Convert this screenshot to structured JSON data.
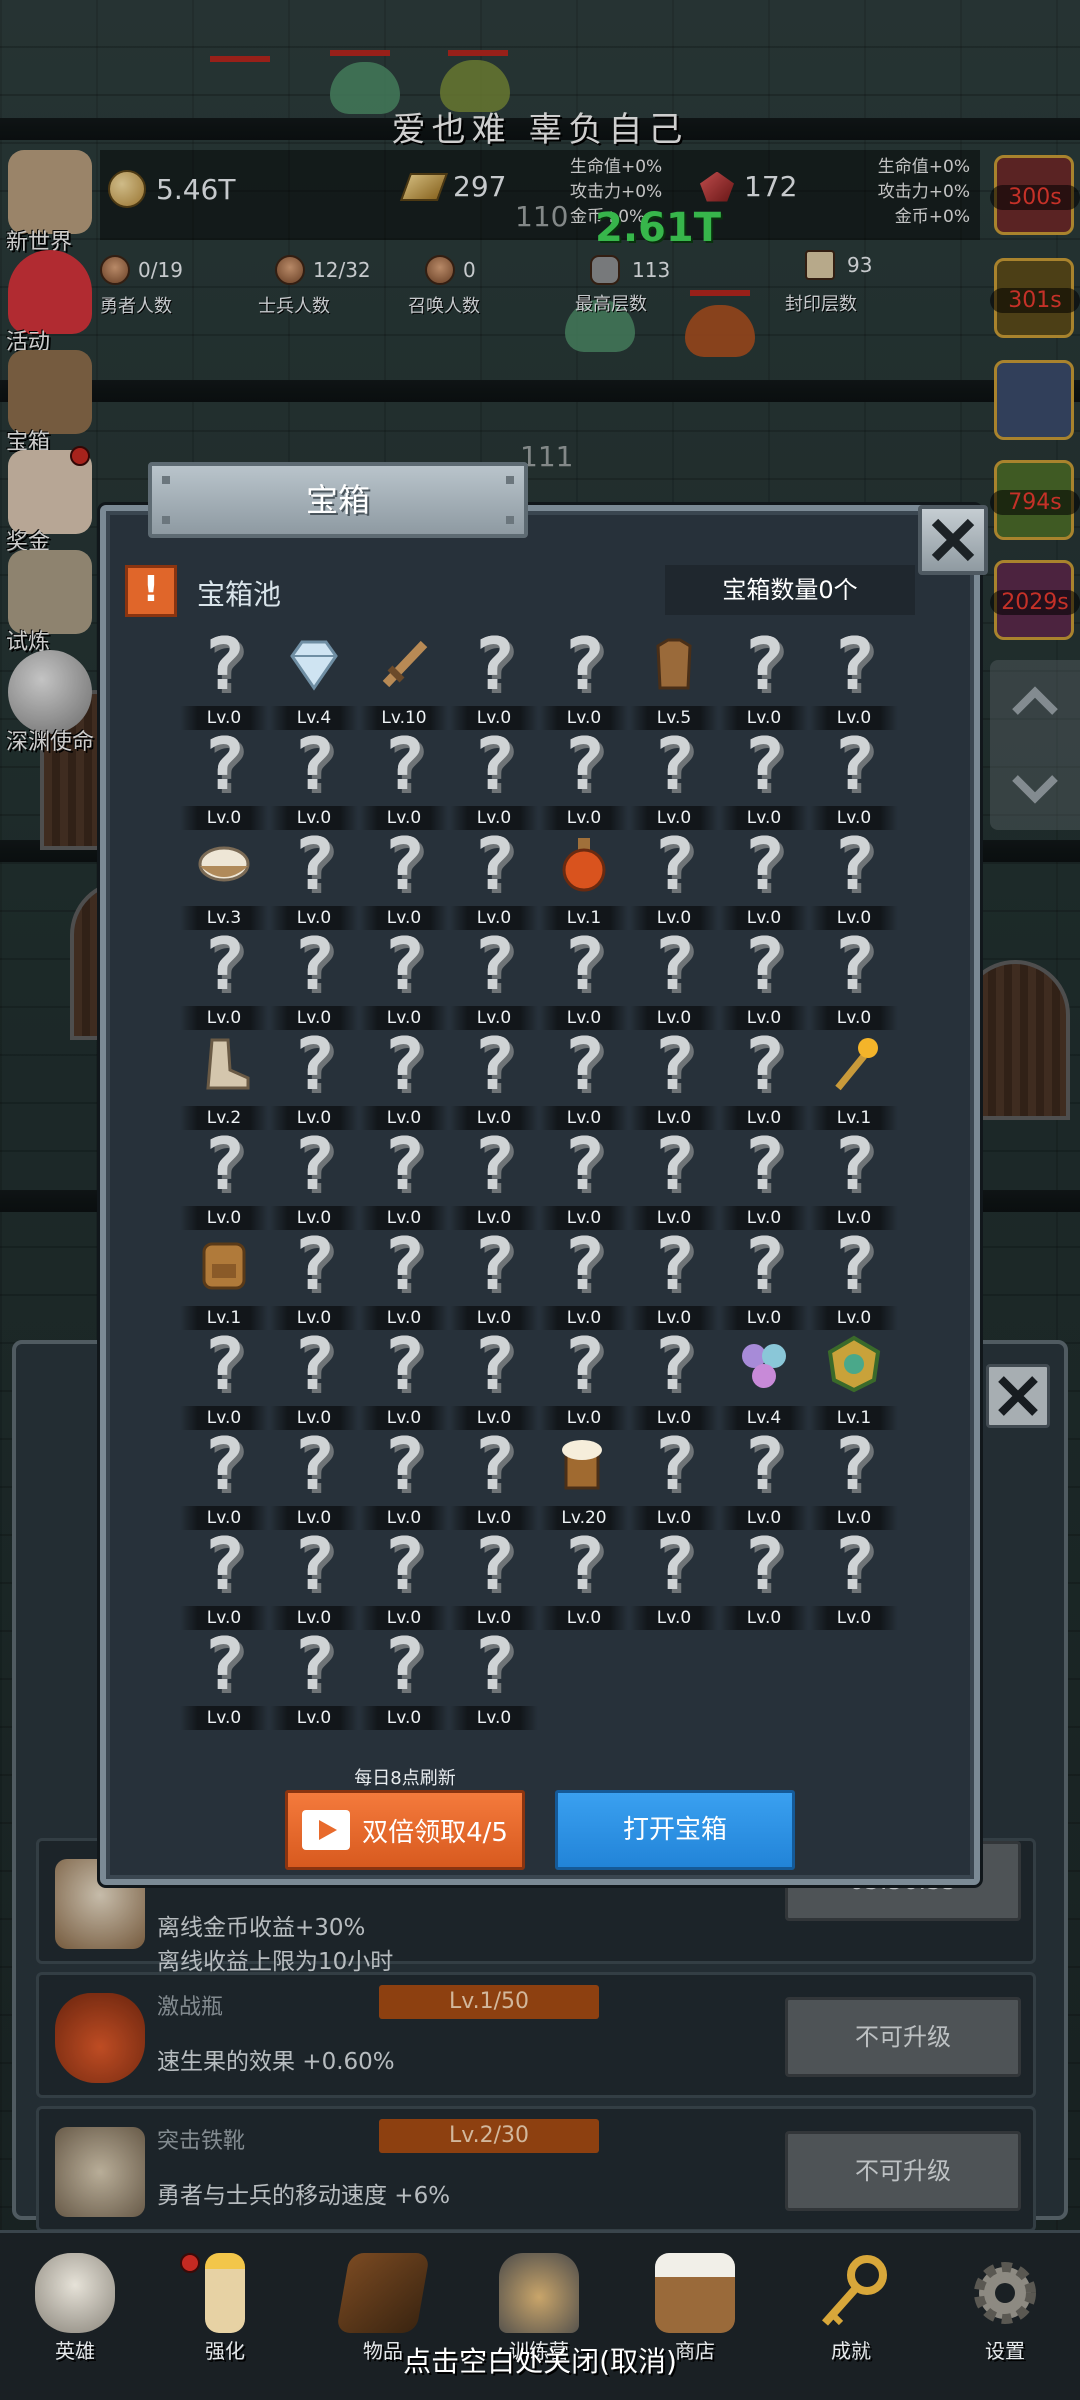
{
  "banner_text": "爱也难 辜负自己",
  "resources": {
    "coins": "5.46T",
    "gold_bars": "297",
    "gems": "172"
  },
  "bonus_left": [
    "生命值+0%",
    "攻击力+0%",
    "金币+0%"
  ],
  "bonus_right": [
    "生命值+0%",
    "攻击力+0%",
    "金币+0%"
  ],
  "floating": {
    "n1": "110",
    "n2": "111",
    "damage": "2.61T"
  },
  "counts": [
    {
      "value": "0/19",
      "label": "勇者人数"
    },
    {
      "value": "12/32",
      "label": "士兵人数"
    },
    {
      "value": "0",
      "label": "召唤人数"
    },
    {
      "value": "113",
      "label": "最高层数"
    },
    {
      "value": "93",
      "label": "封印层数"
    }
  ],
  "left_menu": [
    {
      "label": "新世界",
      "icon": "stone-tablet-icon"
    },
    {
      "label": "活动",
      "icon": "heart-icon"
    },
    {
      "label": "宝箱",
      "icon": "chest-icon"
    },
    {
      "label": "奖金",
      "icon": "letter-icon"
    },
    {
      "label": "试炼",
      "icon": "feather-icon"
    },
    {
      "label": "深渊使命",
      "icon": "orb-icon"
    }
  ],
  "right_timers": [
    "300s",
    "301s",
    "",
    "794s",
    "2029s"
  ],
  "modal": {
    "title": "宝箱",
    "pool_title": "宝箱池",
    "chest_count": "宝箱数量0个",
    "refresh_note": "每日8点刷新",
    "double_claim": "双倍领取4/5",
    "open_chest": "打开宝箱",
    "warn_symbol": "!",
    "unknown_symbol": "?"
  },
  "items": [
    {
      "lv": "Lv.0"
    },
    {
      "lv": "Lv.4",
      "icon": "diamond-icon"
    },
    {
      "lv": "Lv.10",
      "icon": "sword-icon"
    },
    {
      "lv": "Lv.0"
    },
    {
      "lv": "Lv.0"
    },
    {
      "lv": "Lv.5",
      "icon": "armor-icon"
    },
    {
      "lv": "Lv.0"
    },
    {
      "lv": "Lv.0"
    },
    {
      "lv": "Lv.0"
    },
    {
      "lv": "Lv.0"
    },
    {
      "lv": "Lv.0"
    },
    {
      "lv": "Lv.0"
    },
    {
      "lv": "Lv.0"
    },
    {
      "lv": "Lv.0"
    },
    {
      "lv": "Lv.0"
    },
    {
      "lv": "Lv.0"
    },
    {
      "lv": "Lv.3",
      "icon": "rice-bowl-icon"
    },
    {
      "lv": "Lv.0"
    },
    {
      "lv": "Lv.0"
    },
    {
      "lv": "Lv.0"
    },
    {
      "lv": "Lv.1",
      "icon": "potion-icon"
    },
    {
      "lv": "Lv.0"
    },
    {
      "lv": "Lv.0"
    },
    {
      "lv": "Lv.0"
    },
    {
      "lv": "Lv.0"
    },
    {
      "lv": "Lv.0"
    },
    {
      "lv": "Lv.0"
    },
    {
      "lv": "Lv.0"
    },
    {
      "lv": "Lv.0"
    },
    {
      "lv": "Lv.0"
    },
    {
      "lv": "Lv.0"
    },
    {
      "lv": "Lv.0"
    },
    {
      "lv": "Lv.2",
      "icon": "boot-icon"
    },
    {
      "lv": "Lv.0"
    },
    {
      "lv": "Lv.0"
    },
    {
      "lv": "Lv.0"
    },
    {
      "lv": "Lv.0"
    },
    {
      "lv": "Lv.0"
    },
    {
      "lv": "Lv.0"
    },
    {
      "lv": "Lv.1",
      "icon": "torch-icon"
    },
    {
      "lv": "Lv.0"
    },
    {
      "lv": "Lv.0"
    },
    {
      "lv": "Lv.0"
    },
    {
      "lv": "Lv.0"
    },
    {
      "lv": "Lv.0"
    },
    {
      "lv": "Lv.0"
    },
    {
      "lv": "Lv.0"
    },
    {
      "lv": "Lv.0"
    },
    {
      "lv": "Lv.1",
      "icon": "backpack-icon"
    },
    {
      "lv": "Lv.0"
    },
    {
      "lv": "Lv.0"
    },
    {
      "lv": "Lv.0"
    },
    {
      "lv": "Lv.0"
    },
    {
      "lv": "Lv.0"
    },
    {
      "lv": "Lv.0"
    },
    {
      "lv": "Lv.0"
    },
    {
      "lv": "Lv.0"
    },
    {
      "lv": "Lv.0"
    },
    {
      "lv": "Lv.0"
    },
    {
      "lv": "Lv.0"
    },
    {
      "lv": "Lv.0"
    },
    {
      "lv": "Lv.0"
    },
    {
      "lv": "Lv.4",
      "icon": "gem-cluster-icon"
    },
    {
      "lv": "Lv.1",
      "icon": "emblem-icon"
    },
    {
      "lv": "Lv.0"
    },
    {
      "lv": "Lv.0"
    },
    {
      "lv": "Lv.0"
    },
    {
      "lv": "Lv.0"
    },
    {
      "lv": "Lv.20",
      "icon": "ale-mug-icon"
    },
    {
      "lv": "Lv.0"
    },
    {
      "lv": "Lv.0"
    },
    {
      "lv": "Lv.0"
    },
    {
      "lv": "Lv.0"
    },
    {
      "lv": "Lv.0"
    },
    {
      "lv": "Lv.0"
    },
    {
      "lv": "Lv.0"
    },
    {
      "lv": "Lv.0"
    },
    {
      "lv": "Lv.0"
    },
    {
      "lv": "Lv.0"
    },
    {
      "lv": "Lv.0"
    },
    {
      "lv": "Lv.0"
    },
    {
      "lv": "Lv.0"
    },
    {
      "lv": "Lv.0"
    },
    {
      "lv": "Lv.0"
    }
  ],
  "under_rows": [
    {
      "name": "",
      "desc1": "离线金币收益+30%",
      "desc2": "离线收益上限为10小时",
      "level": "",
      "button": "03:56:35",
      "icon": "rice-bowl-icon"
    },
    {
      "name": "激战瓶",
      "desc1": "速生果的效果 +0.60%",
      "desc2": "",
      "level": "Lv.1/50",
      "button": "不可升级",
      "icon": "potion-icon"
    },
    {
      "name": "突击铁靴",
      "desc1": "勇者与士兵的移动速度 +6%",
      "desc2": "",
      "level": "Lv.2/30",
      "button": "不可升级",
      "icon": "boot-icon"
    }
  ],
  "bottom_nav": [
    {
      "label": "英雄",
      "icon": "skull-icon"
    },
    {
      "label": "强化",
      "icon": "candle-icon"
    },
    {
      "label": "物品",
      "icon": "book-icon"
    },
    {
      "label": "训练营",
      "icon": "lantern-icon"
    },
    {
      "label": "商店",
      "icon": "mug-icon"
    },
    {
      "label": "成就",
      "icon": "key-icon"
    },
    {
      "label": "设置",
      "icon": "gear-icon"
    }
  ],
  "dismiss_hint": "点击空白处关闭(取消)",
  "colors": {
    "modal_bg": "#27313a",
    "orange_button": "#e86a2c",
    "blue_button": "#2a8fe0",
    "timer_red": "#e83a2f",
    "damage_green": "#41d659"
  }
}
